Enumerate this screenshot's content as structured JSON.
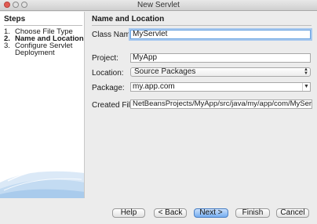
{
  "window": {
    "title": "New Servlet"
  },
  "steps": {
    "heading": "Steps",
    "items": [
      {
        "num": "1.",
        "label": "Choose File Type",
        "active": false
      },
      {
        "num": "2.",
        "label": "Name and Location",
        "active": true
      },
      {
        "num": "3.",
        "label": "Configure Servlet",
        "active": false
      },
      {
        "num": "",
        "label": "Deployment",
        "active": false
      }
    ]
  },
  "main": {
    "heading": "Name and Location",
    "class_name": {
      "label": "Class Name:",
      "value": "MyServlet"
    },
    "project": {
      "label": "Project:",
      "value": "MyApp"
    },
    "location": {
      "label": "Location:",
      "value": "Source Packages"
    },
    "package": {
      "label": "Package:",
      "value": "my.app.com"
    },
    "created_file": {
      "label": "Created File:",
      "value": "NetBeansProjects/MyApp/src/java/my/app/com/MyServlet.java"
    }
  },
  "footer": {
    "help": "Help",
    "back": "< Back",
    "next": "Next >",
    "finish": "Finish",
    "cancel": "Cancel"
  },
  "colors": {
    "accent": "#76aef0",
    "focus_ring": "#a7c8ef"
  }
}
